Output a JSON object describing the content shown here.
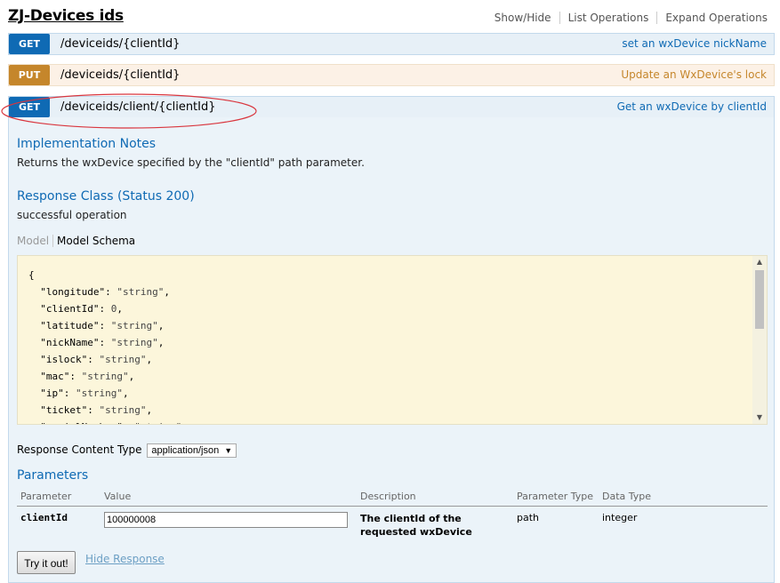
{
  "resource": {
    "title": "ZJ-Devices ids",
    "links": [
      "Show/Hide",
      "List Operations",
      "Expand Operations"
    ]
  },
  "operations": [
    {
      "method": "GET",
      "path": "/deviceids/{clientId}",
      "summary": "set an wxDevice nickName"
    },
    {
      "method": "PUT",
      "path": "/deviceids/{clientId}",
      "summary": "Update an WxDevice's lock"
    },
    {
      "method": "GET",
      "path": "/deviceids/client/{clientId}",
      "summary": "Get an wxDevice by clientId"
    }
  ],
  "details": {
    "impl_heading": "Implementation Notes",
    "impl_text": "Returns the wxDevice specified by the \"clientId\" path parameter.",
    "resp_heading": "Response Class (Status 200)",
    "resp_text": "successful operation",
    "model_tab": "Model",
    "schema_tab": "Model Schema",
    "schema_lines": [
      {
        "k": "",
        "v": "{",
        "type": "brace"
      },
      {
        "k": "longitude",
        "v": "\"string\"",
        "type": "str"
      },
      {
        "k": "clientId",
        "v": "0",
        "type": "num"
      },
      {
        "k": "latitude",
        "v": "\"string\"",
        "type": "str"
      },
      {
        "k": "nickName",
        "v": "\"string\"",
        "type": "str"
      },
      {
        "k": "islock",
        "v": "\"string\"",
        "type": "str"
      },
      {
        "k": "mac",
        "v": "\"string\"",
        "type": "str"
      },
      {
        "k": "ip",
        "v": "\"string\"",
        "type": "str"
      },
      {
        "k": "ticket",
        "v": "\"string\"",
        "type": "str"
      },
      {
        "k": "serialNumber",
        "v": "\"string\"",
        "type": "str"
      }
    ],
    "response_content_type_label": "Response Content Type",
    "response_content_type_value": "application/json",
    "params_heading": "Parameters",
    "params_headers": [
      "Parameter",
      "Value",
      "Description",
      "Parameter Type",
      "Data Type"
    ],
    "params": [
      {
        "name": "clientId",
        "value": "100000008",
        "description": "The clientId of the requested wxDevice",
        "ptype": "path",
        "dtype": "integer"
      }
    ],
    "try_button": "Try it out!",
    "hide_response": "Hide Response"
  },
  "colors": {
    "get": "#0f6ab4",
    "put": "#c5862b",
    "annotation": "#d9363e"
  }
}
